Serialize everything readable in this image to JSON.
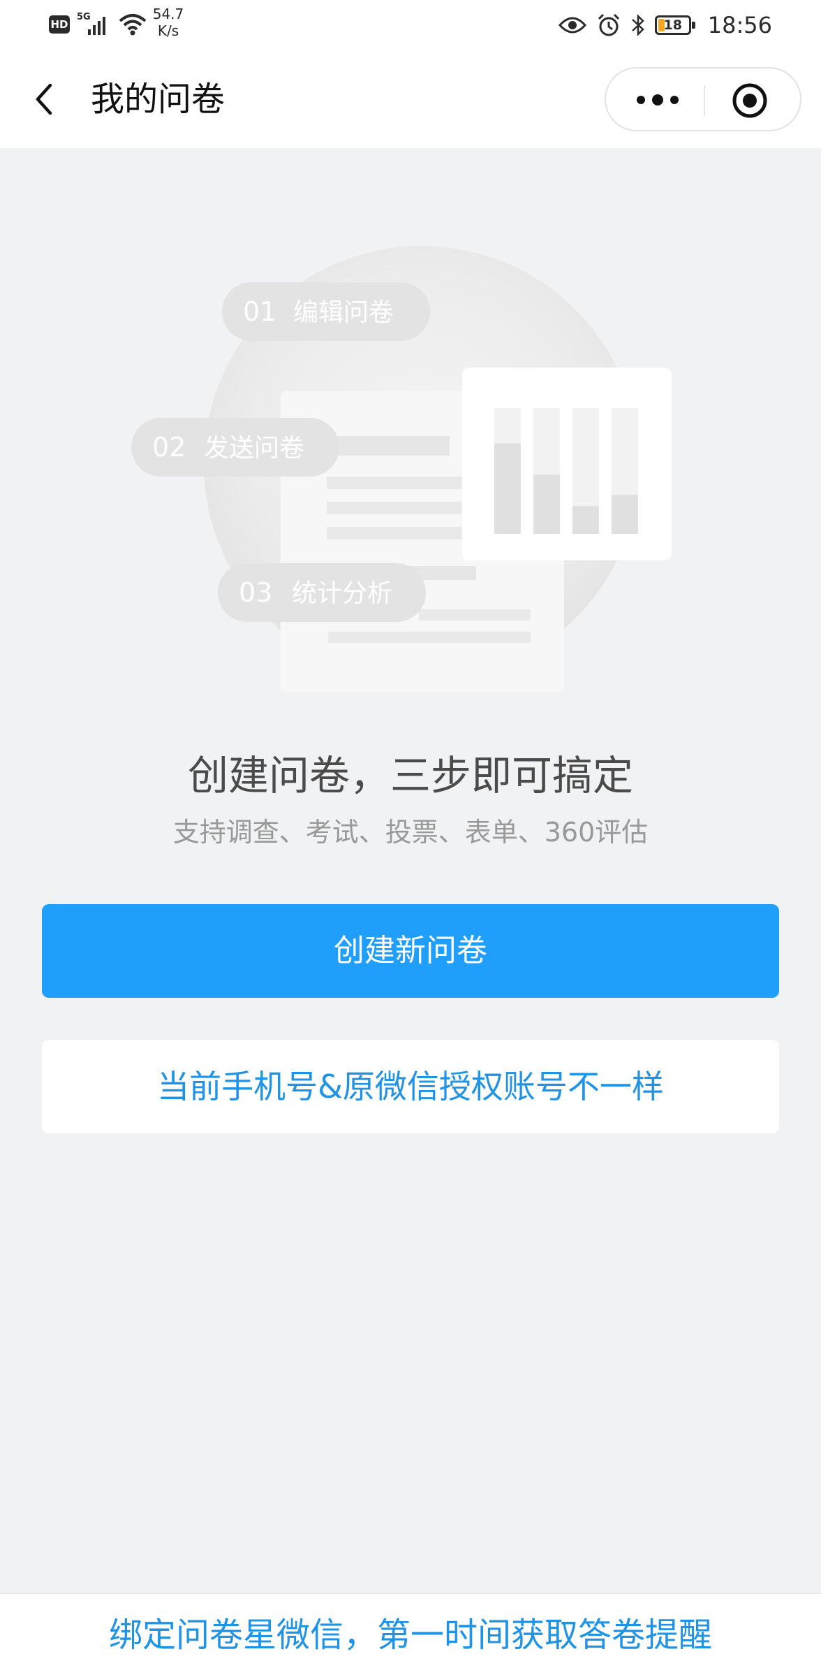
{
  "status_bar": {
    "hd": "HD",
    "network": "5G",
    "speed_value": "54.7",
    "speed_unit": "K/s",
    "battery": "18",
    "time": "18:56",
    "icons": [
      "hd-icon",
      "signal-icon",
      "wifi-icon",
      "eye-icon",
      "alarm-icon",
      "bluetooth-icon",
      "battery-icon"
    ]
  },
  "nav": {
    "title": "我的问卷",
    "icons": [
      "back-icon",
      "more-icon",
      "close-target-icon"
    ]
  },
  "illustration": {
    "steps": [
      {
        "num": "01",
        "label": "编辑问卷"
      },
      {
        "num": "02",
        "label": "发送问卷"
      },
      {
        "num": "03",
        "label": "统计分析"
      }
    ],
    "bar_levels": [
      0.72,
      0.47,
      0.22,
      0.31
    ]
  },
  "main": {
    "headline": "创建问卷，三步即可搞定",
    "subline": "支持调查、考试、投票、表单、360评估",
    "create_button": "创建新问卷",
    "notice_button": "当前手机号&原微信授权账号不一样"
  },
  "footer": {
    "link": "绑定问卷星微信，第一时间获取答卷提醒"
  },
  "colors": {
    "primary": "#1f9efb",
    "link": "#1f93e6",
    "background": "#f1f2f4"
  }
}
